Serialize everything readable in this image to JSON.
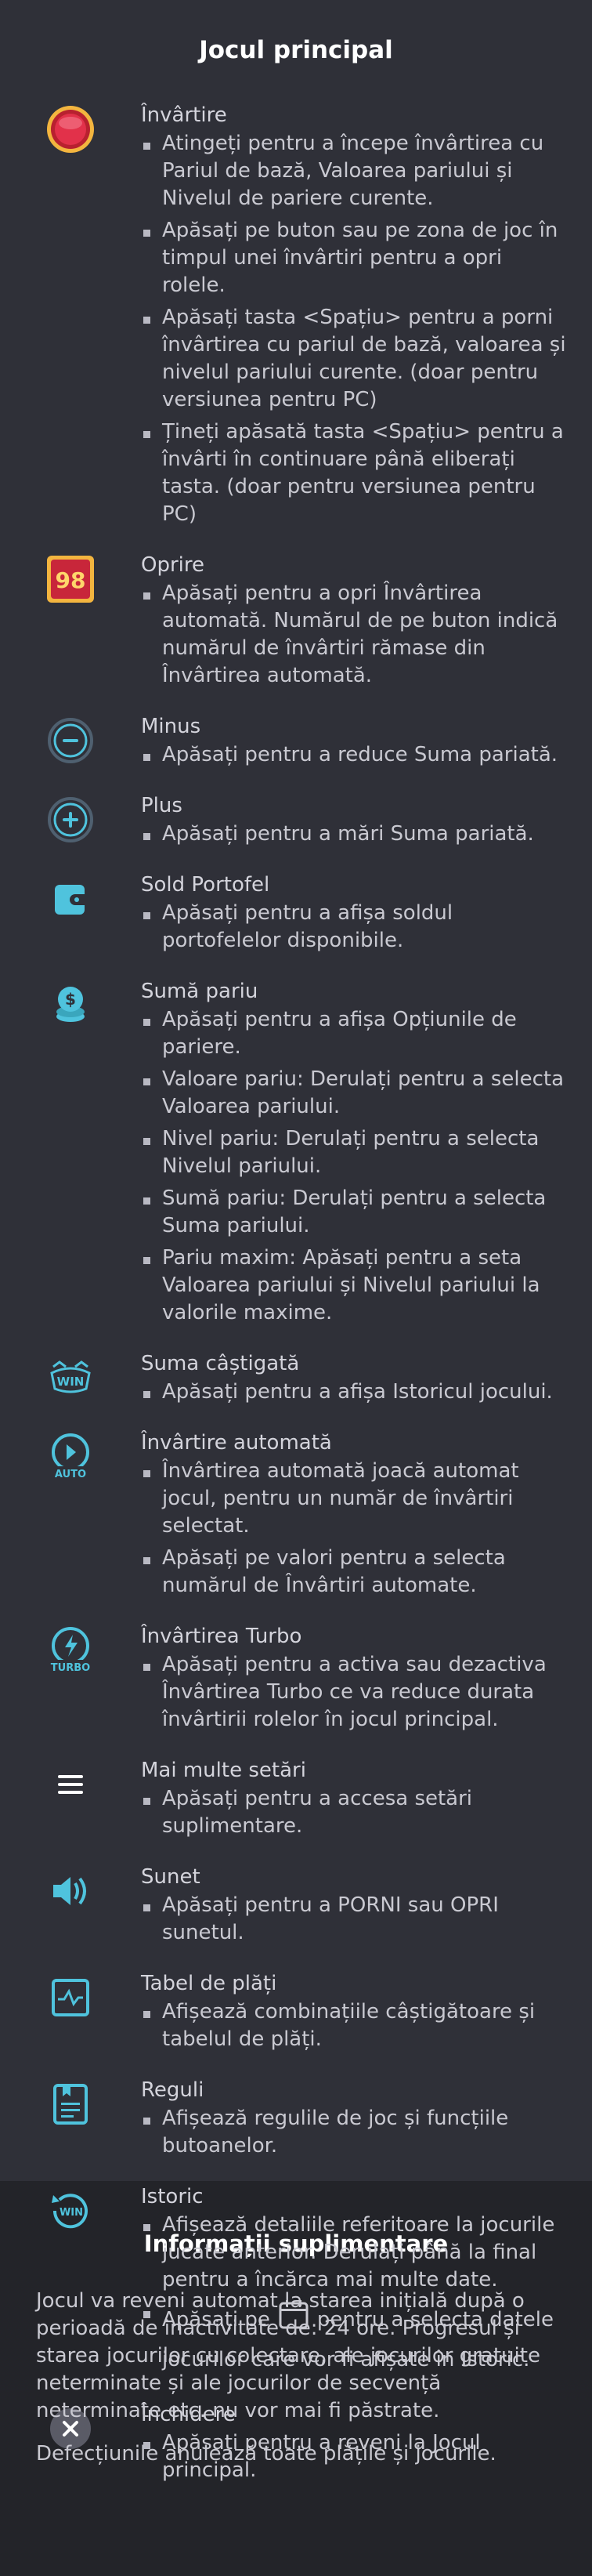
{
  "main_title": "Jocul principal",
  "items": [
    {
      "icon": "spin-icon",
      "title": "Învârtire",
      "bullets": [
        "Atingeți pentru a începe învârtirea cu Pariul de bază, Valoarea pariului și Nivelul de pariere curente.",
        "Apăsați pe buton sau pe zona de joc în timpul unei învârtiri pentru a opri rolele.",
        "Apăsați tasta <Spațiu> pentru a porni învârtirea cu pariul de bază, valoarea și nivelul pariului curente. (doar pentru versiunea pentru PC)",
        "Țineți apăsată tasta <Spațiu> pentru a învârti în continuare până eliberați tasta. (doar pentru versiunea pentru PC)"
      ]
    },
    {
      "icon": "stop-autospin-icon",
      "icon_text": "98",
      "title": "Oprire",
      "bullets": [
        "Apăsați pentru a opri Învârtirea automată. Numărul de pe buton indică numărul de învârtiri rămase din Învârtirea automată."
      ]
    },
    {
      "icon": "minus-icon",
      "title": "Minus",
      "bullets": [
        "Apăsați pentru a reduce Suma pariată."
      ]
    },
    {
      "icon": "plus-icon",
      "title": "Plus",
      "bullets": [
        "Apăsați pentru a mări Suma pariată."
      ]
    },
    {
      "icon": "wallet-icon",
      "title": "Sold Portofel",
      "bullets": [
        "Apăsați pentru a afișa soldul portofelelor disponibile."
      ]
    },
    {
      "icon": "coins-icon",
      "title": "Sumă pariu",
      "bullets": [
        "Apăsați pentru a afișa Opțiunile de pariere.",
        "Valoare pariu: Derulați pentru a selecta Valoarea pariului.",
        "Nivel pariu: Derulați pentru a selecta Nivelul pariului.",
        "Sumă pariu: Derulați pentru a selecta Suma pariului.",
        "Pariu maxim: Apăsați pentru a seta Valoarea pariului și Nivelul pariului la valorile maxime."
      ]
    },
    {
      "icon": "win-icon",
      "icon_text": "WIN",
      "title": "Suma câștigată",
      "bullets": [
        "Apăsați pentru a afișa Istoricul jocului."
      ]
    },
    {
      "icon": "autoplay-icon",
      "icon_text": "AUTO",
      "title": "Învârtire automată",
      "bullets": [
        "Învârtirea automată joacă automat jocul, pentru un număr de învârtiri selectat.",
        "Apăsați pe valori pentru a selecta numărul de Învârtiri automate."
      ]
    },
    {
      "icon": "turbo-icon",
      "icon_text": "TURBO",
      "title": "Învârtirea Turbo",
      "bullets": [
        "Apăsați pentru a activa sau dezactiva Învârtirea Turbo ce va reduce durata învârtirii rolelor în jocul principal."
      ]
    },
    {
      "icon": "menu-icon",
      "title": "Mai multe setări",
      "bullets": [
        "Apăsați pentru a accesa setări suplimentare."
      ]
    },
    {
      "icon": "sound-icon",
      "title": "Sunet",
      "bullets": [
        "Apăsați pentru a PORNI sau OPRI sunetul."
      ]
    },
    {
      "icon": "paytable-icon",
      "title": "Tabel de plăți",
      "bullets": [
        "Afișează combinațiile câștigătoare și tabelul de plăți."
      ]
    },
    {
      "icon": "rules-icon",
      "title": "Reguli",
      "bullets": [
        "Afișează regulile de joc și funcțiile butoanelor."
      ]
    },
    {
      "icon": "history-icon",
      "icon_text": "WIN",
      "title": "Istoric",
      "bullets": [
        "Afișează detaliile referitoare la jocurile jucate anterior. Derulați până la final pentru a încărca mai multe date."
      ],
      "calendar_bullet": {
        "before": "Apăsați pe",
        "after": "pentru a selecta datele jocurilor care vor fi afișate în Istoric."
      }
    },
    {
      "icon": "close-icon",
      "title": "Închidere",
      "bullets": [
        "Apăsați pentru a reveni la Jocul principal."
      ]
    }
  ],
  "extra": {
    "title": "Informații suplimentare",
    "paragraphs": [
      "Jocul va reveni automat la starea inițială după o perioadă de inactivitate de: 24 ore. Progresul și starea jocurilor cu colectare, ale jocurilor gratuite neterminate și ale jocurilor de secvență neterminate etc. nu vor mai fi păstrate.",
      "Defecțiunile anulează toate plățile și jocurile."
    ]
  },
  "colors": {
    "accent": "#4fc3dd",
    "background": "#2f3038",
    "footer_bg": "#232429",
    "spin_red": "#e2314a",
    "spin_gold": "#f3b53f"
  }
}
